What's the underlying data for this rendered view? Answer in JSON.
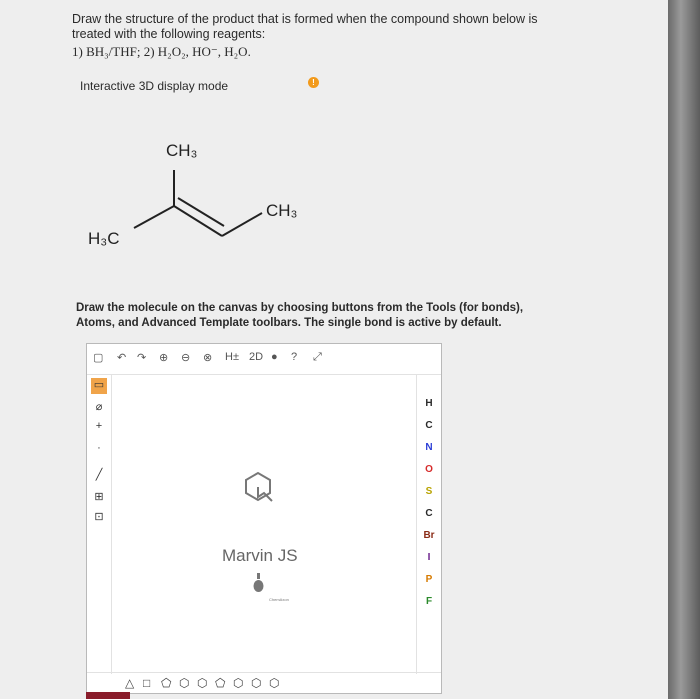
{
  "question": {
    "line1": "Draw the structure of the product that is formed when the compound shown below is",
    "line2": "treated with the following reagents:",
    "reagents": "1) BH₃/THF; 2) H₂O₂, HO⁻, H₂O."
  },
  "display_mode": {
    "label": "Interactive 3D display mode",
    "info_icon": "!"
  },
  "molecule": {
    "labels": [
      "CH₃",
      "CH₃",
      "H₃C"
    ]
  },
  "instructions": {
    "line1": "Draw the molecule on the canvas by choosing buttons from the Tools (for bonds),",
    "line2": "Atoms, and Advanced Template toolbars. The single bond is active by default."
  },
  "editor": {
    "top_toolbar": [
      "▢",
      "↶",
      "↷",
      "⊕",
      "⊖",
      "⊗",
      "H±",
      "2D",
      "●",
      "?",
      "⤢"
    ],
    "left_toolbar": [
      "▭",
      "⌀",
      "+",
      "·",
      "╱",
      "⊞",
      "⊡"
    ],
    "atoms": [
      "H",
      "C",
      "N",
      "O",
      "S",
      "C",
      "Br",
      "I",
      "P",
      "F"
    ],
    "atom_colors": [
      "#222222",
      "#222222",
      "#2b3ed6",
      "#d62b2b",
      "#b8a300",
      "#222222",
      "#8a2b16",
      "#6b1f8c",
      "#d67a00",
      "#2b8a2b"
    ],
    "bottom_toolbar": [
      "△",
      "□",
      "⬠",
      "⬡",
      "⬡",
      "⬠",
      "⬡",
      "⬡",
      "⬡"
    ],
    "brand": "Marvin JS",
    "brand_sub": "ChemAxon"
  }
}
